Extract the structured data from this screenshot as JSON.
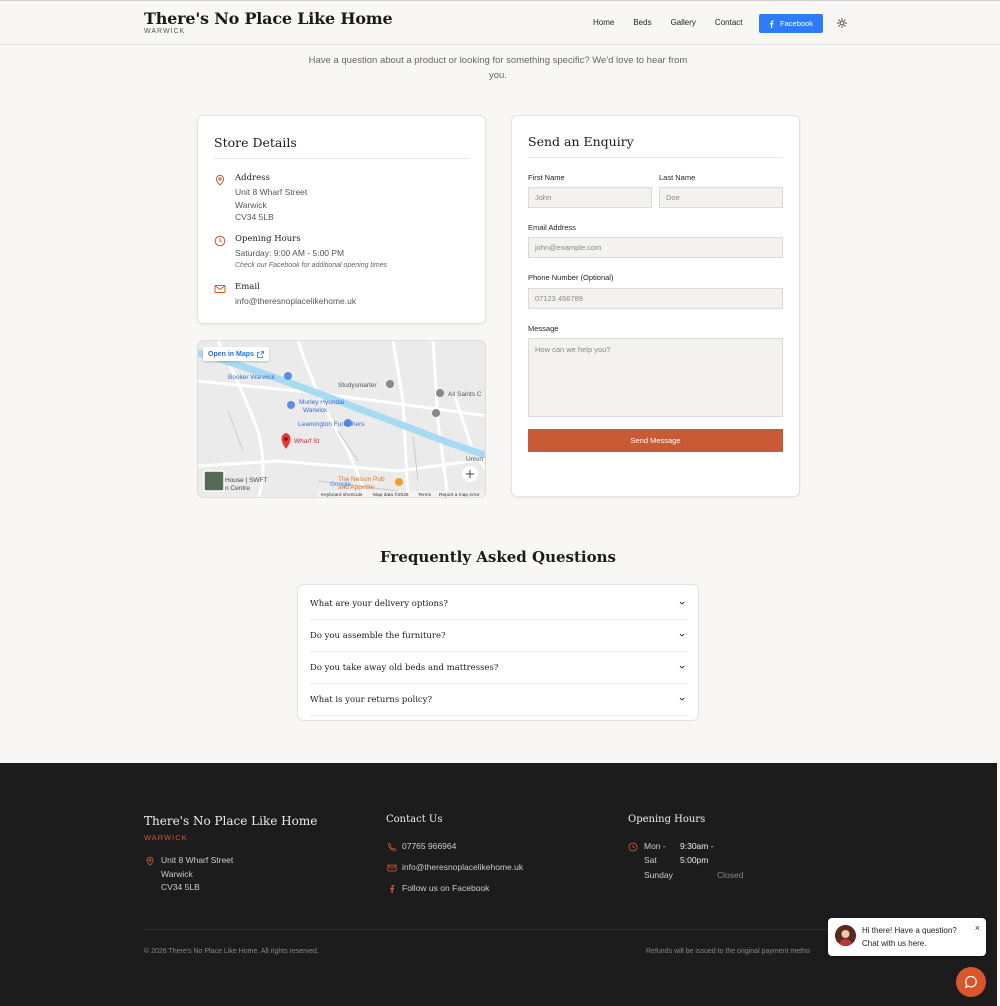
{
  "header": {
    "brand_title": "There's No Place Like Home",
    "brand_sub": "WARWICK",
    "nav": [
      "Home",
      "Beds",
      "Gallery",
      "Contact"
    ],
    "facebook_label": "Facebook"
  },
  "intro": "Have a question about a product or looking for something specific? We'd love to hear from you.",
  "store": {
    "title": "Store Details",
    "address_label": "Address",
    "address_lines": [
      "Unit 8 Wharf Street",
      "Warwick",
      "CV34 5LB"
    ],
    "hours_label": "Opening Hours",
    "hours_value": "Saturday: 9:00 AM - 5:00 PM",
    "hours_note": "Check our Facebook for additional opening times",
    "email_label": "Email",
    "email_value": "info@theresnoplacelikehome.uk"
  },
  "map": {
    "open_label": "Open in Maps",
    "labels": {
      "booker": "Booker Warwick",
      "studysmarter": "Studysmarter",
      "allsaints": "All Saints C",
      "murley": "Murley Hyundai",
      "murley2": "Warwick",
      "leamington": "Leamington Furnishers",
      "wharf": "Wharf St",
      "nelson1": "The Nelson Pub",
      "nelson2": "and Appetite",
      "house1": "House | SWFT",
      "house2": "n Centre",
      "google": "Google",
      "union": "Union",
      "keyboard": "Keyboard shortcuts",
      "mapdata": "Map data ©2026",
      "terms": "Terms",
      "report": "Report a map error"
    }
  },
  "enquiry": {
    "title": "Send an Enquiry",
    "first_label": "First Name",
    "first_ph": "John",
    "last_label": "Last Name",
    "last_ph": "Doe",
    "email_label": "Email Address",
    "email_ph": "john@example.com",
    "phone_label": "Phone Number (Optional)",
    "phone_ph": "07123 456789",
    "message_label": "Message",
    "message_ph": "How can we help you?",
    "send_label": "Send Message"
  },
  "faq": {
    "title": "Frequently Asked Questions",
    "items": [
      "What are your delivery options?",
      "Do you assemble the furniture?",
      "Do you take away old beds and mattresses?",
      "What is your returns policy?"
    ]
  },
  "footer": {
    "brand": "There's No Place Like Home",
    "brand_sub": "WARWICK",
    "address_lines": [
      "Unit 8 Wharf Street",
      "Warwick",
      "CV34 5LB"
    ],
    "contact_title": "Contact Us",
    "phone": "07765 966964",
    "email": "info@theresnoplacelikehome.uk",
    "facebook": "Follow us on Facebook",
    "hours_title": "Opening Hours",
    "hours_day1a": "Mon -",
    "hours_day1b": "Sat",
    "hours_time1a": "9:30am -",
    "hours_time1b": "5:00pm",
    "hours_day2": "Sunday",
    "hours_time2": "Closed",
    "copyright": "© 2026 There's No Place Like Home. All rights reserved.",
    "refund": "Refunds will be issued to the original payment metho"
  },
  "chat": {
    "line1": "Hi there! Have a question?",
    "line2": "Chat with us here.",
    "close": "×"
  },
  "colors": {
    "accent": "#c95a36",
    "facebook": "#2d7cf6",
    "footer_bg": "#1c1c1c"
  }
}
